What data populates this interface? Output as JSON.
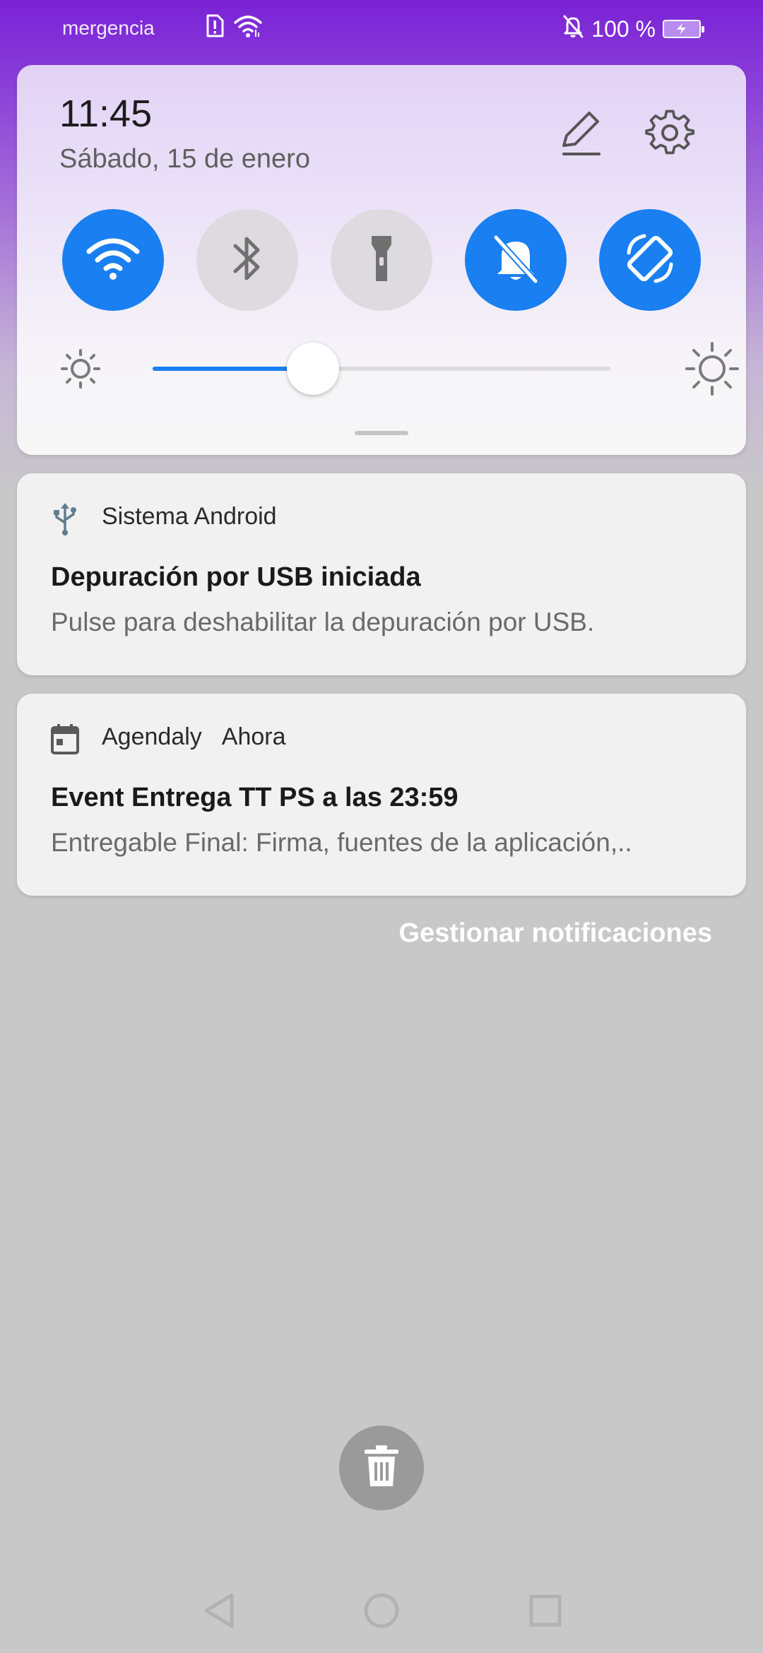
{
  "status_bar": {
    "carrier": "mergencia",
    "battery": "100 %",
    "icons": [
      "sim-alert-icon",
      "wifi-icon",
      "bell-off-icon",
      "battery-charging-icon"
    ]
  },
  "quick_settings": {
    "time": "11:45",
    "date": "Sábado, 15 de enero",
    "tiles": [
      {
        "name": "wifi",
        "icon": "wifi-icon",
        "state": "on"
      },
      {
        "name": "bluetooth",
        "icon": "bluetooth-icon",
        "state": "off"
      },
      {
        "name": "flashlight",
        "icon": "flashlight-icon",
        "state": "off"
      },
      {
        "name": "do-not-disturb",
        "icon": "bell-off-icon",
        "state": "on"
      },
      {
        "name": "auto-rotate",
        "icon": "rotate-icon",
        "state": "on"
      }
    ],
    "brightness": 0.35,
    "colors": {
      "active": "#1a7ff0",
      "inactive": "#dedbe0"
    }
  },
  "notifications": [
    {
      "app": "Sistema Android",
      "time": "",
      "icon": "usb-icon",
      "title": "Depuración por USB iniciada",
      "body": "Pulse para deshabilitar la depuración por USB."
    },
    {
      "app": "Agendaly",
      "time": "Ahora",
      "icon": "calendar-icon",
      "title": "Event Entrega TT PS a las 23:59",
      "body": "Entregable Final: Firma, fuentes de la aplicación,.."
    }
  ],
  "manage_label": "Gestionar notificaciones",
  "nav_icons": [
    "back-icon",
    "home-icon",
    "recents-icon"
  ]
}
